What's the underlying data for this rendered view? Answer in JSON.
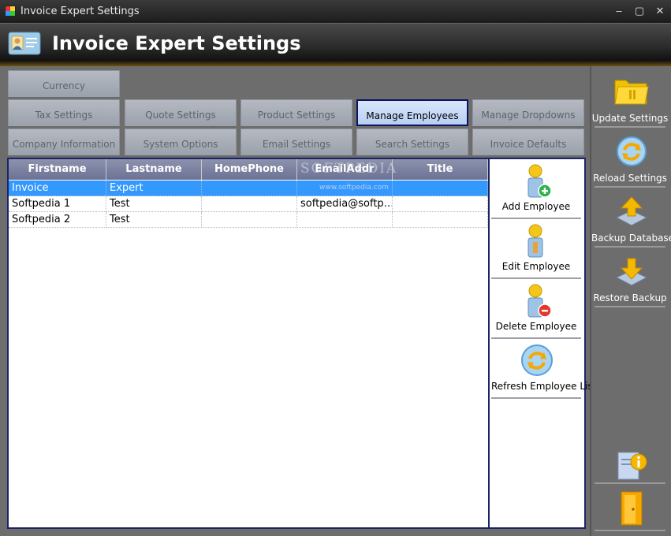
{
  "window": {
    "title": "Invoice Expert Settings",
    "min": "–",
    "max": "▢",
    "close": "✕"
  },
  "header": {
    "title": "Invoice Expert Settings"
  },
  "tabs": {
    "row1": [
      "Currency"
    ],
    "row2": [
      "Tax Settings",
      "Quote Settings",
      "Product Settings",
      "Manage Employees",
      "Manage Dropdowns"
    ],
    "row3": [
      "Company Information",
      "System Options",
      "Email Settings",
      "Search Settings",
      "Invoice Defaults"
    ],
    "active": "Manage Employees"
  },
  "grid": {
    "columns": [
      "Firstname",
      "Lastname",
      "HomePhone",
      "EmailAddr",
      "Title"
    ],
    "rows": [
      [
        "Invoice",
        "Expert",
        "",
        "",
        ""
      ],
      [
        "Softpedia 1",
        "Test",
        "",
        "softpedia@softp…",
        ""
      ],
      [
        "Softpedia 2",
        "Test",
        "",
        "",
        ""
      ]
    ],
    "selected_row": 0,
    "watermark": "SOFTPEDIA",
    "watermark_url": "www.softpedia.com"
  },
  "actions": {
    "add": "Add Employee",
    "edit": "Edit Employee",
    "delete": "Delete Employee",
    "refresh": "Refresh Employee List"
  },
  "sidebar": {
    "update": "Update Settings",
    "reload": "Reload Settings",
    "backup": "Backup Database",
    "restore": "Restore Backup"
  },
  "colors": {
    "accent": "#0c1460",
    "selection": "#3399ff",
    "header_gradient": "#6b7294"
  }
}
